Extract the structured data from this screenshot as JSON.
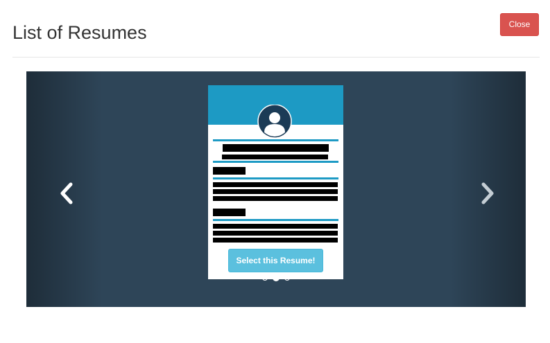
{
  "modal": {
    "title": "List of Resumes",
    "close_label": "Close"
  },
  "carousel": {
    "prev_icon": "chevron-left-icon",
    "next_icon": "chevron-right-icon",
    "slide_count": 3,
    "active_index": 1,
    "select_label": "Select this Resume!"
  },
  "colors": {
    "danger": "#d9534f",
    "info": "#5bc0de",
    "accent": "#1d9ac4",
    "carousel_bg": "#2e4558"
  }
}
